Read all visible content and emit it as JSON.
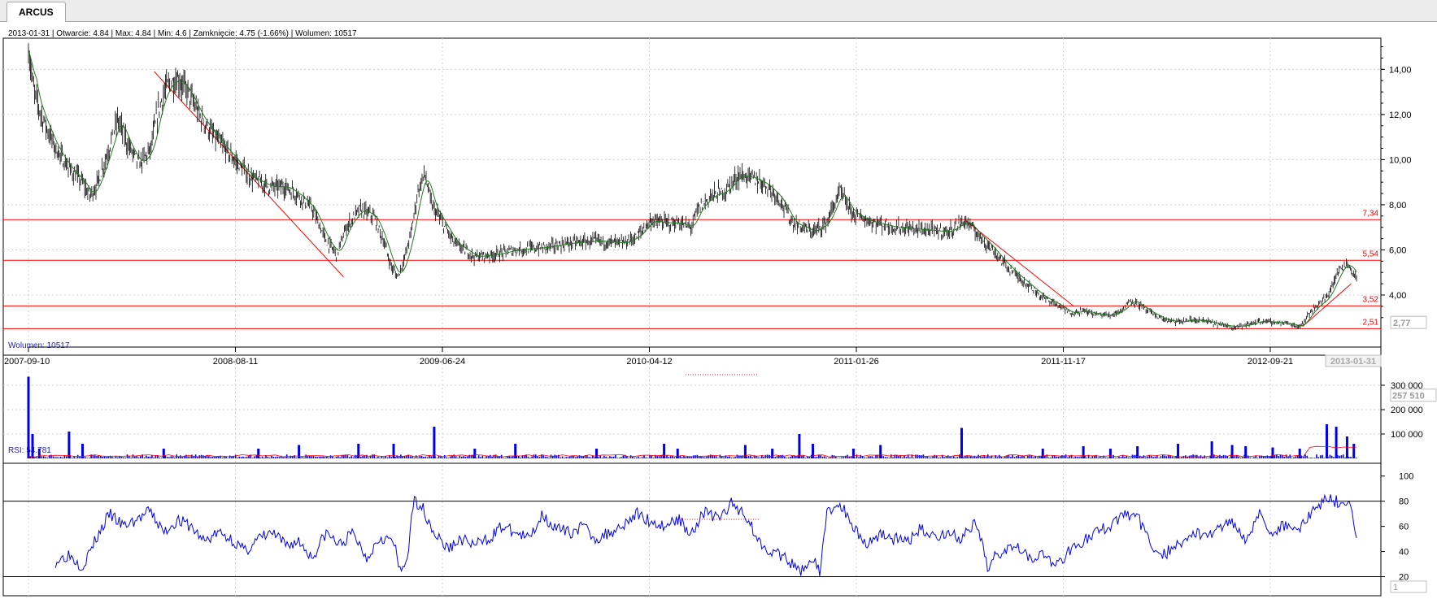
{
  "tab": {
    "label": "ARCUS"
  },
  "info": {
    "main": "2013-01-31 | Otwarcie: 4.84 | Max: 4.84 | Min: 4.6 | Zamknięcie: 4.75 (-1.66%) | Wolumen: 10517",
    "volume": "Wolumen: 10517",
    "rsi": "RSI: 54.781"
  },
  "chart_data": [
    {
      "type": "line",
      "name": "price",
      "x_ticks": [
        "2007-09-10",
        "2008-08-11",
        "2009-06-24",
        "2010-04-12",
        "2011-01-26",
        "2011-11-17",
        "2012-09-21"
      ],
      "current_date": "2013-01-31",
      "y_ticks": [
        "14,00",
        "12,00",
        "10,00",
        "8,00",
        "6,00",
        "4,00"
      ],
      "ylim": [
        2.2,
        15.2
      ],
      "current_value": "2,77",
      "levels": [
        {
          "value": 7.34,
          "label": "7,34"
        },
        {
          "value": 5.54,
          "label": "5,54"
        },
        {
          "value": 3.52,
          "label": "3,52"
        },
        {
          "value": 2.51,
          "label": "2,51"
        }
      ],
      "trendlines": [
        {
          "from": [
            0.093,
            13.9
          ],
          "to": [
            0.233,
            4.8
          ]
        },
        {
          "from": [
            0.693,
            7.3
          ],
          "to": [
            0.773,
            3.5
          ]
        },
        {
          "from": [
            0.942,
            2.6
          ],
          "to": [
            0.978,
            4.5
          ]
        }
      ],
      "series_x_range": [
        0,
        0.982
      ],
      "anchors": [
        [
          0.0,
          14.9
        ],
        [
          0.004,
          13.0
        ],
        [
          0.01,
          11.9
        ],
        [
          0.02,
          10.5
        ],
        [
          0.03,
          9.6
        ],
        [
          0.04,
          9.0
        ],
        [
          0.045,
          8.4
        ],
        [
          0.05,
          8.8
        ],
        [
          0.058,
          10.2
        ],
        [
          0.066,
          11.8
        ],
        [
          0.074,
          10.6
        ],
        [
          0.082,
          9.8
        ],
        [
          0.09,
          10.4
        ],
        [
          0.096,
          12.2
        ],
        [
          0.102,
          13.2
        ],
        [
          0.11,
          13.6
        ],
        [
          0.118,
          13.0
        ],
        [
          0.126,
          12.0
        ],
        [
          0.135,
          11.2
        ],
        [
          0.145,
          10.5
        ],
        [
          0.155,
          9.8
        ],
        [
          0.165,
          9.2
        ],
        [
          0.178,
          8.8
        ],
        [
          0.19,
          8.8
        ],
        [
          0.2,
          8.4
        ],
        [
          0.21,
          7.8
        ],
        [
          0.22,
          6.4
        ],
        [
          0.228,
          5.8
        ],
        [
          0.235,
          7.0
        ],
        [
          0.245,
          7.8
        ],
        [
          0.255,
          7.5
        ],
        [
          0.262,
          6.5
        ],
        [
          0.268,
          5.3
        ],
        [
          0.273,
          4.8
        ],
        [
          0.278,
          5.6
        ],
        [
          0.283,
          6.8
        ],
        [
          0.288,
          8.6
        ],
        [
          0.293,
          9.4
        ],
        [
          0.298,
          8.0
        ],
        [
          0.305,
          7.3
        ],
        [
          0.315,
          6.3
        ],
        [
          0.33,
          5.7
        ],
        [
          0.345,
          5.8
        ],
        [
          0.36,
          6.0
        ],
        [
          0.38,
          6.1
        ],
        [
          0.4,
          6.3
        ],
        [
          0.42,
          6.4
        ],
        [
          0.44,
          6.3
        ],
        [
          0.45,
          6.6
        ],
        [
          0.46,
          7.3
        ],
        [
          0.47,
          7.2
        ],
        [
          0.48,
          7.2
        ],
        [
          0.49,
          7.0
        ],
        [
          0.495,
          7.8
        ],
        [
          0.505,
          8.4
        ],
        [
          0.515,
          8.6
        ],
        [
          0.525,
          9.3
        ],
        [
          0.535,
          9.2
        ],
        [
          0.545,
          8.9
        ],
        [
          0.555,
          8.3
        ],
        [
          0.565,
          7.2
        ],
        [
          0.58,
          6.8
        ],
        [
          0.59,
          7.2
        ],
        [
          0.6,
          8.6
        ],
        [
          0.608,
          7.7
        ],
        [
          0.62,
          7.3
        ],
        [
          0.64,
          7.0
        ],
        [
          0.66,
          6.9
        ],
        [
          0.68,
          6.8
        ],
        [
          0.693,
          7.3
        ],
        [
          0.7,
          6.8
        ],
        [
          0.71,
          6.2
        ],
        [
          0.72,
          5.5
        ],
        [
          0.73,
          4.9
        ],
        [
          0.74,
          4.4
        ],
        [
          0.75,
          3.9
        ],
        [
          0.76,
          3.6
        ],
        [
          0.77,
          3.2
        ],
        [
          0.78,
          3.3
        ],
        [
          0.79,
          3.15
        ],
        [
          0.8,
          3.1
        ],
        [
          0.81,
          3.4
        ],
        [
          0.815,
          3.8
        ],
        [
          0.82,
          3.6
        ],
        [
          0.83,
          3.2
        ],
        [
          0.84,
          2.9
        ],
        [
          0.85,
          2.8
        ],
        [
          0.86,
          2.9
        ],
        [
          0.87,
          2.85
        ],
        [
          0.88,
          2.7
        ],
        [
          0.89,
          2.6
        ],
        [
          0.9,
          2.65
        ],
        [
          0.91,
          2.85
        ],
        [
          0.92,
          2.8
        ],
        [
          0.93,
          2.75
        ],
        [
          0.94,
          2.6
        ],
        [
          0.95,
          3.4
        ],
        [
          0.96,
          3.9
        ],
        [
          0.97,
          5.2
        ],
        [
          0.975,
          5.4
        ],
        [
          0.982,
          4.75
        ]
      ]
    },
    {
      "type": "bar",
      "name": "volume",
      "y_ticks": [
        "300 000",
        "200 000",
        "100 000"
      ],
      "ylim": [
        0,
        340000
      ],
      "current_value": "257 510",
      "spikes": [
        [
          0.0,
          335000
        ],
        [
          0.003,
          100000
        ],
        [
          0.008,
          40000
        ],
        [
          0.03,
          110000
        ],
        [
          0.04,
          60000
        ],
        [
          0.1,
          40000
        ],
        [
          0.17,
          40000
        ],
        [
          0.2,
          55000
        ],
        [
          0.244,
          60000
        ],
        [
          0.27,
          60000
        ],
        [
          0.3,
          130000
        ],
        [
          0.33,
          40000
        ],
        [
          0.36,
          60000
        ],
        [
          0.42,
          40000
        ],
        [
          0.47,
          60000
        ],
        [
          0.48,
          40000
        ],
        [
          0.53,
          55000
        ],
        [
          0.55,
          40000
        ],
        [
          0.57,
          100000
        ],
        [
          0.58,
          60000
        ],
        [
          0.61,
          40000
        ],
        [
          0.63,
          55000
        ],
        [
          0.69,
          125000
        ],
        [
          0.75,
          40000
        ],
        [
          0.78,
          50000
        ],
        [
          0.8,
          40000
        ],
        [
          0.82,
          50000
        ],
        [
          0.85,
          60000
        ],
        [
          0.875,
          70000
        ],
        [
          0.89,
          55000
        ],
        [
          0.9,
          50000
        ],
        [
          0.92,
          45000
        ],
        [
          0.94,
          40000
        ],
        [
          0.96,
          140000
        ],
        [
          0.967,
          130000
        ],
        [
          0.975,
          90000
        ],
        [
          0.98,
          60000
        ]
      ]
    },
    {
      "type": "line",
      "name": "RSI",
      "y_ticks": [
        "100",
        "80",
        "60",
        "40",
        "20"
      ],
      "ylim": [
        10,
        105
      ],
      "guides": [
        80,
        20
      ],
      "current_value": "1",
      "series_x_range": [
        0.02,
        0.982
      ],
      "anchors": [
        [
          0.02,
          32
        ],
        [
          0.03,
          38
        ],
        [
          0.04,
          28
        ],
        [
          0.05,
          50
        ],
        [
          0.06,
          70
        ],
        [
          0.07,
          60
        ],
        [
          0.08,
          65
        ],
        [
          0.09,
          72
        ],
        [
          0.1,
          55
        ],
        [
          0.11,
          65
        ],
        [
          0.12,
          60
        ],
        [
          0.13,
          48
        ],
        [
          0.14,
          55
        ],
        [
          0.15,
          50
        ],
        [
          0.16,
          40
        ],
        [
          0.17,
          50
        ],
        [
          0.18,
          55
        ],
        [
          0.19,
          45
        ],
        [
          0.2,
          48
        ],
        [
          0.21,
          35
        ],
        [
          0.22,
          55
        ],
        [
          0.23,
          45
        ],
        [
          0.24,
          55
        ],
        [
          0.25,
          35
        ],
        [
          0.26,
          52
        ],
        [
          0.27,
          48
        ],
        [
          0.275,
          22
        ],
        [
          0.28,
          35
        ],
        [
          0.285,
          80
        ],
        [
          0.29,
          78
        ],
        [
          0.3,
          55
        ],
        [
          0.31,
          42
        ],
        [
          0.32,
          50
        ],
        [
          0.33,
          45
        ],
        [
          0.34,
          50
        ],
        [
          0.35,
          60
        ],
        [
          0.36,
          55
        ],
        [
          0.37,
          50
        ],
        [
          0.38,
          70
        ],
        [
          0.39,
          58
        ],
        [
          0.4,
          55
        ],
        [
          0.41,
          60
        ],
        [
          0.42,
          50
        ],
        [
          0.43,
          55
        ],
        [
          0.44,
          62
        ],
        [
          0.45,
          70
        ],
        [
          0.46,
          64
        ],
        [
          0.47,
          60
        ],
        [
          0.48,
          66
        ],
        [
          0.49,
          55
        ],
        [
          0.5,
          72
        ],
        [
          0.51,
          66
        ],
        [
          0.52,
          78
        ],
        [
          0.53,
          70
        ],
        [
          0.54,
          48
        ],
        [
          0.55,
          40
        ],
        [
          0.56,
          34
        ],
        [
          0.57,
          24
        ],
        [
          0.58,
          35
        ],
        [
          0.585,
          22
        ],
        [
          0.59,
          70
        ],
        [
          0.6,
          78
        ],
        [
          0.61,
          60
        ],
        [
          0.62,
          45
        ],
        [
          0.63,
          55
        ],
        [
          0.64,
          50
        ],
        [
          0.65,
          48
        ],
        [
          0.66,
          58
        ],
        [
          0.67,
          52
        ],
        [
          0.68,
          55
        ],
        [
          0.69,
          50
        ],
        [
          0.7,
          62
        ],
        [
          0.705,
          45
        ],
        [
          0.71,
          25
        ],
        [
          0.715,
          38
        ],
        [
          0.72,
          40
        ],
        [
          0.73,
          48
        ],
        [
          0.74,
          35
        ],
        [
          0.75,
          38
        ],
        [
          0.76,
          28
        ],
        [
          0.77,
          42
        ],
        [
          0.78,
          48
        ],
        [
          0.79,
          56
        ],
        [
          0.8,
          60
        ],
        [
          0.81,
          70
        ],
        [
          0.82,
          68
        ],
        [
          0.83,
          45
        ],
        [
          0.84,
          38
        ],
        [
          0.85,
          45
        ],
        [
          0.86,
          55
        ],
        [
          0.87,
          52
        ],
        [
          0.88,
          58
        ],
        [
          0.89,
          65
        ],
        [
          0.9,
          50
        ],
        [
          0.91,
          70
        ],
        [
          0.92,
          55
        ],
        [
          0.93,
          62
        ],
        [
          0.94,
          58
        ],
        [
          0.95,
          72
        ],
        [
          0.96,
          84
        ],
        [
          0.97,
          78
        ],
        [
          0.975,
          82
        ],
        [
          0.982,
          55
        ]
      ]
    }
  ]
}
